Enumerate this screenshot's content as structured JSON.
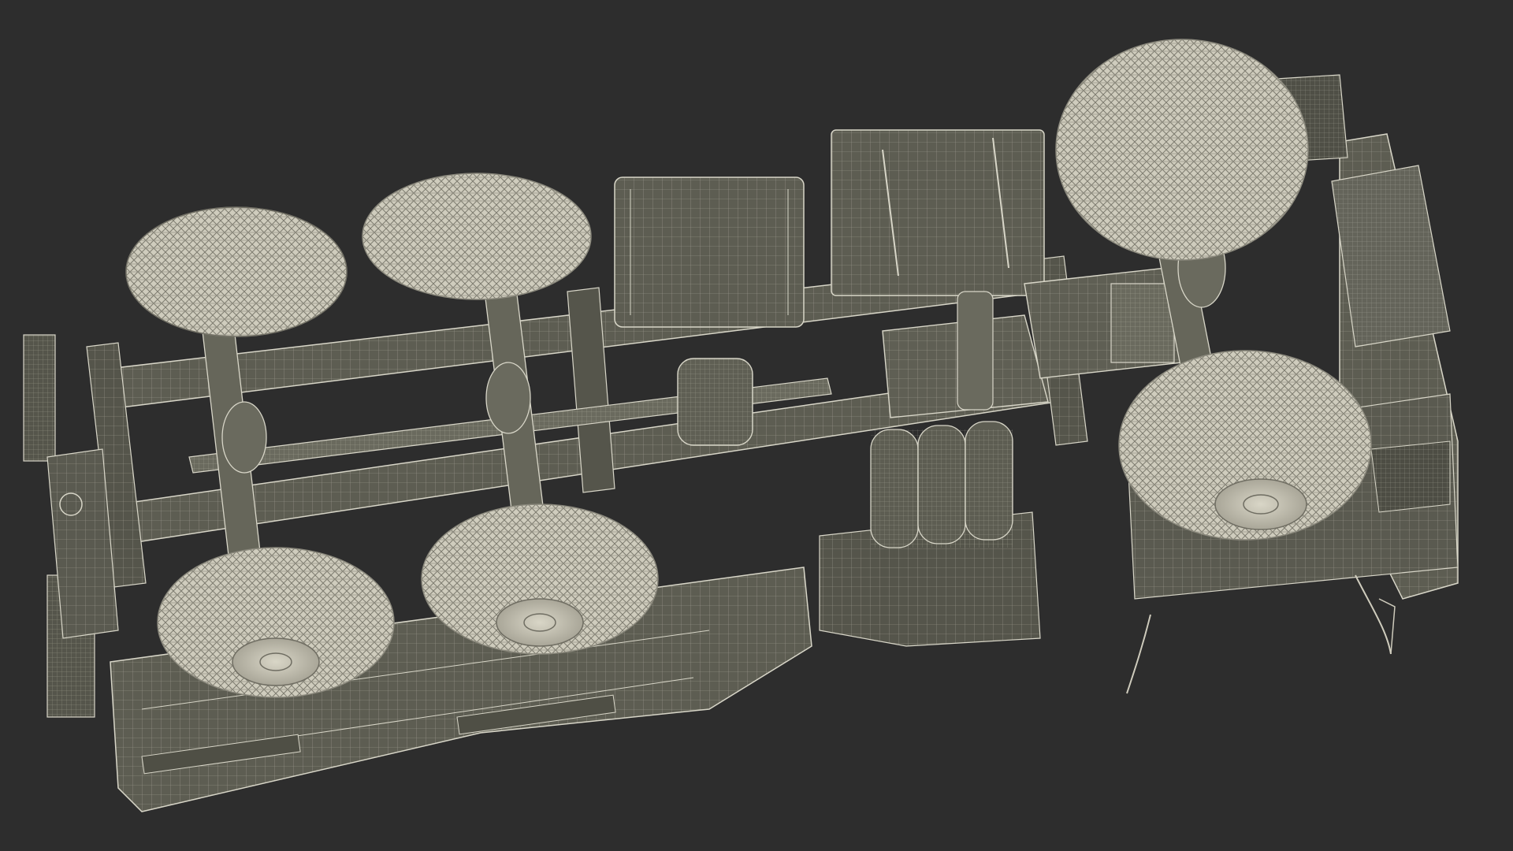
{
  "scene": {
    "background_color": "#2d2d2d",
    "model_fill": "#5d5d52",
    "model_fill_dark": "#45453d",
    "model_fill_light": "#6e6e62",
    "wire_color": "#d8d6c8",
    "tire_fill": "#cfccbd",
    "tire_wire": "#8a887c"
  }
}
